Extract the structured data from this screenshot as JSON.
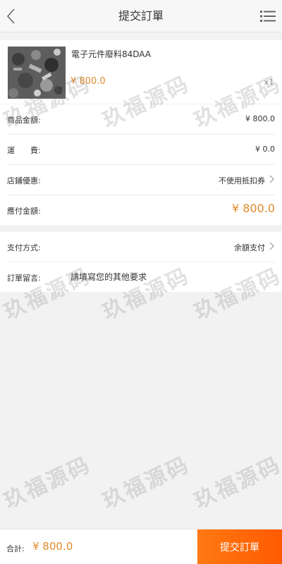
{
  "header": {
    "title": "提交訂單",
    "back_icon": "chevron-left-icon",
    "menu_icon": "list-icon"
  },
  "product": {
    "name": "電子元件廢料84DAA",
    "price": "¥ 800.0",
    "quantity": "x1"
  },
  "summary": {
    "items": [
      {
        "label": "商品金額:",
        "value": "¥ 800.0"
      },
      {
        "label": "運　　費:",
        "value": "¥ 0.0"
      },
      {
        "label": "店鋪優惠:",
        "value": "不使用抵扣券"
      },
      {
        "label": "應付金額:",
        "value": "¥ 800.0"
      }
    ]
  },
  "payment": {
    "label": "支付方式:",
    "value": "余額支付"
  },
  "note": {
    "label": "訂單留言:",
    "placeholder": "請填寫您的其他要求"
  },
  "bottom": {
    "total_label": "合計:",
    "total_value": "¥ 800.0",
    "submit_label": "提交訂單"
  },
  "watermark": "玖福源码",
  "colors": {
    "accent": "#e08a2a",
    "button": "#ff6a00",
    "background": "#f2f2f2"
  }
}
